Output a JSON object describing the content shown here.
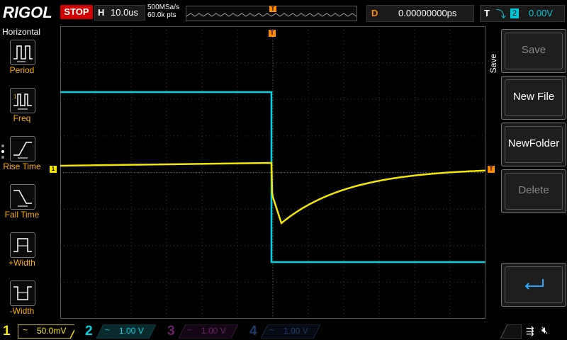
{
  "brand": "RIGOL",
  "run_state": "STOP",
  "horizontal": {
    "label": "H",
    "scale": "10.0us"
  },
  "acquisition": {
    "sample_rate": "500MSa/s",
    "points": "60.0k pts"
  },
  "trigger_position_marker": "T",
  "delay": {
    "label": "D",
    "value": "0.00000000ps"
  },
  "trigger": {
    "label": "T",
    "source": "2",
    "level": "0.00V"
  },
  "left_menu": {
    "title": "Horizontal",
    "items": [
      {
        "label": "Period",
        "icon": "period-icon"
      },
      {
        "label": "Freq",
        "icon": "freq-icon"
      },
      {
        "label": "Rise Time",
        "icon": "rise-time-icon"
      },
      {
        "label": "Fall Time",
        "icon": "fall-time-icon"
      },
      {
        "label": "+Width",
        "icon": "positive-width-icon"
      },
      {
        "label": "-Width",
        "icon": "negative-width-icon"
      }
    ]
  },
  "right_menu": {
    "section": "Save",
    "items": [
      {
        "label": "Save",
        "enabled": false
      },
      {
        "label": "New File",
        "enabled": true
      },
      {
        "label": "NewFolder",
        "enabled": true
      },
      {
        "label": "Delete",
        "enabled": false
      },
      {
        "label": "",
        "icon": "return-arrow-icon",
        "enabled": true
      }
    ]
  },
  "channels": [
    {
      "num": "1",
      "coupling": "~",
      "scale": "50.0mV",
      "color": "#f5e600",
      "active": true
    },
    {
      "num": "2",
      "coupling": "~",
      "scale": "1.00 V",
      "color": "#00d4e4",
      "active": true
    },
    {
      "num": "3",
      "coupling": "~",
      "scale": "1.00 V",
      "color": "#d400d4",
      "active": false
    },
    {
      "num": "4",
      "coupling": "~",
      "scale": "1.00 V",
      "color": "#2080ff",
      "active": false
    }
  ],
  "status_icons": [
    "usb-icon",
    "mute-icon"
  ],
  "colors": {
    "ch1": "#f5e600",
    "ch2": "#00d4e4",
    "trigger": "#ff8c00",
    "stop": "#d10000",
    "menu_label": "#ffb000"
  }
}
